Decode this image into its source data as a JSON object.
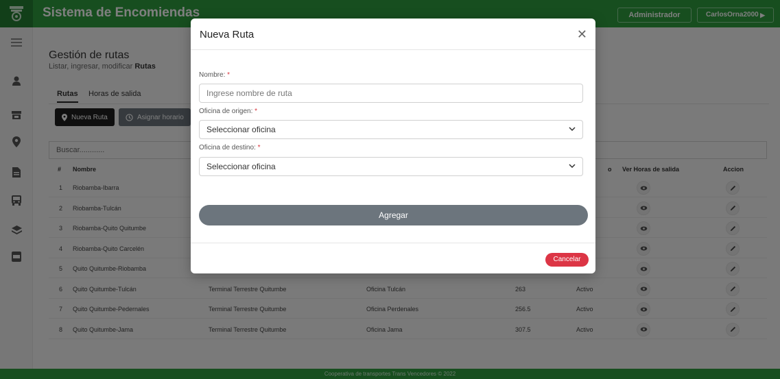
{
  "header": {
    "app_title": "Sistema de Encomiendas",
    "admin_label": "Administrador",
    "user_label": "CarlosOrna2000"
  },
  "page": {
    "title": "Gestión de rutas",
    "subtitle_prefix": "Listar, ingresar, modificar",
    "subtitle_bold": "Rutas",
    "tabs": [
      "Rutas",
      "Horas de salida"
    ],
    "btn_new_route": "Nueva Ruta",
    "btn_assign": "Asignar horario",
    "search_placeholder": "Buscar............"
  },
  "table": {
    "headers": {
      "num": "#",
      "name": "Nombre",
      "status_partial": "o",
      "view_hours": "Ver Horas de salida",
      "action": "Accion"
    },
    "rows": [
      {
        "num": "1",
        "name": "Riobamba-Ibarra"
      },
      {
        "num": "2",
        "name": "Riobamba-Tulcán"
      },
      {
        "num": "3",
        "name": "Riobamba-Quito Quitumbe"
      },
      {
        "num": "4",
        "name": "Riobamba-Quito Carcelén"
      },
      {
        "num": "5",
        "name": "Quito Quitumbe-Riobamba"
      },
      {
        "num": "6",
        "name": "Quito Quitumbe-Tulcán",
        "origin": "Terminal Terrestre Quitumbe",
        "dest": "Oficina Tulcán",
        "price": "263",
        "status": "Activo"
      },
      {
        "num": "7",
        "name": "Quito Quitumbe-Pedernales",
        "origin": "Terminal Terrestre Quitumbe",
        "dest": "Oficina Perdenales",
        "price": "256.5",
        "status": "Activo"
      },
      {
        "num": "8",
        "name": "Quito Quitumbe-Jama",
        "origin": "Terminal Terrestre Quitumbe",
        "dest": "Oficina Jama",
        "price": "307.5",
        "status": "Activo"
      }
    ]
  },
  "footer": {
    "text": "Cooperativa de transportes Trans Vencedores © 2022"
  },
  "modal": {
    "title": "Nueva Ruta",
    "name_label": "Nombre:",
    "name_placeholder": "Ingrese nombre de ruta",
    "origin_label": "Oficina de origen:",
    "origin_value": "Seleccionar oficina",
    "dest_label": "Oficina de destino:",
    "dest_value": "Seleccionar oficina",
    "required_mark": "*",
    "add_label": "Agregar",
    "cancel_label": "Cancelar"
  },
  "colors": {
    "brand_green": "#2f9d3f",
    "dark_button": "#1f1f1f",
    "secondary_button": "#6c757d",
    "danger": "#dc3545"
  },
  "icons": [
    "menu-icon",
    "user-icon",
    "store-icon",
    "map-pin-icon",
    "document-icon",
    "bus-icon",
    "layers-icon",
    "pdf-icon",
    "eye-icon",
    "pencil-icon",
    "clock-icon",
    "close-icon",
    "chevron-down-icon"
  ]
}
